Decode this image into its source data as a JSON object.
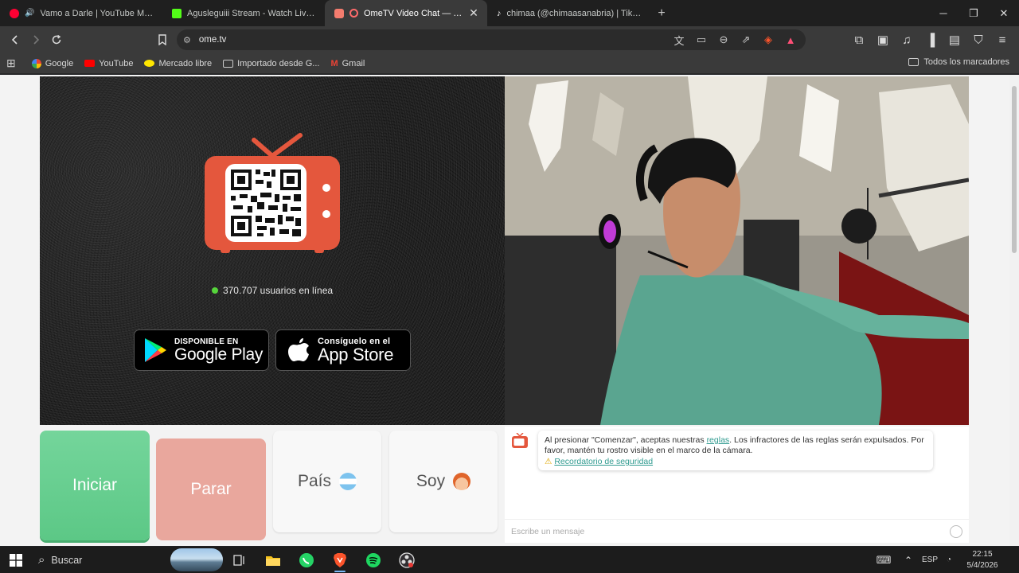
{
  "tabs": [
    {
      "title": "Vamo a Darle | YouTube Music",
      "color": "#ff0033",
      "active": false
    },
    {
      "title": "Agusleguiii Stream - Watch Live on K",
      "color": "#53fc18",
      "active": false
    },
    {
      "title": "OmeTV Video Chat — Omegle",
      "color": "#ff5555",
      "active": true
    },
    {
      "title": "chimaa (@chimaasanabria) | TikTok",
      "color": "#ffffff",
      "active": false
    }
  ],
  "toolbar": {
    "url": "ome.tv"
  },
  "bookmarks": [
    {
      "label": "Google",
      "icon": "google-icon"
    },
    {
      "label": "YouTube",
      "icon": "youtube-icon"
    },
    {
      "label": "Mercado libre",
      "icon": "mercadolibre-icon"
    },
    {
      "label": "Importado desde G...",
      "icon": "folder-icon"
    },
    {
      "label": "Gmail",
      "icon": "gmail-icon"
    }
  ],
  "bookmarks_all": "Todos los marcadores",
  "page": {
    "online_count": "370.707 usuarios en línea",
    "google_play": {
      "small": "DISPONIBLE EN",
      "big": "Google Play"
    },
    "app_store": {
      "small": "Consíguelo en el",
      "big": "App Store"
    },
    "start_label": "Iniciar",
    "stop_label": "Parar",
    "country_label": "País",
    "country_flag": "🇦🇷",
    "me_label": "Soy",
    "me_emoji": "🧑",
    "notice_before": "Al presionar \"Comenzar\", aceptas nuestras",
    "notice_link": "reglas",
    "notice_after": ". Los infractores de las reglas serán expulsados. Por favor, mantén tu rostro visible en el marco de la cámara.",
    "safety_link": "Recordatorio de seguridad",
    "chat_placeholder": "Escribe un mensaje",
    "logo_text": "Ome TV"
  },
  "taskbar": {
    "search_label": "Buscar",
    "language": "ESP",
    "time": "22:15",
    "date": "5/4/2026"
  },
  "colors": {
    "start": "#5cc886",
    "stop": "#e9a79d",
    "tv_red": "#e4573d",
    "link": "#2f9a8f"
  }
}
